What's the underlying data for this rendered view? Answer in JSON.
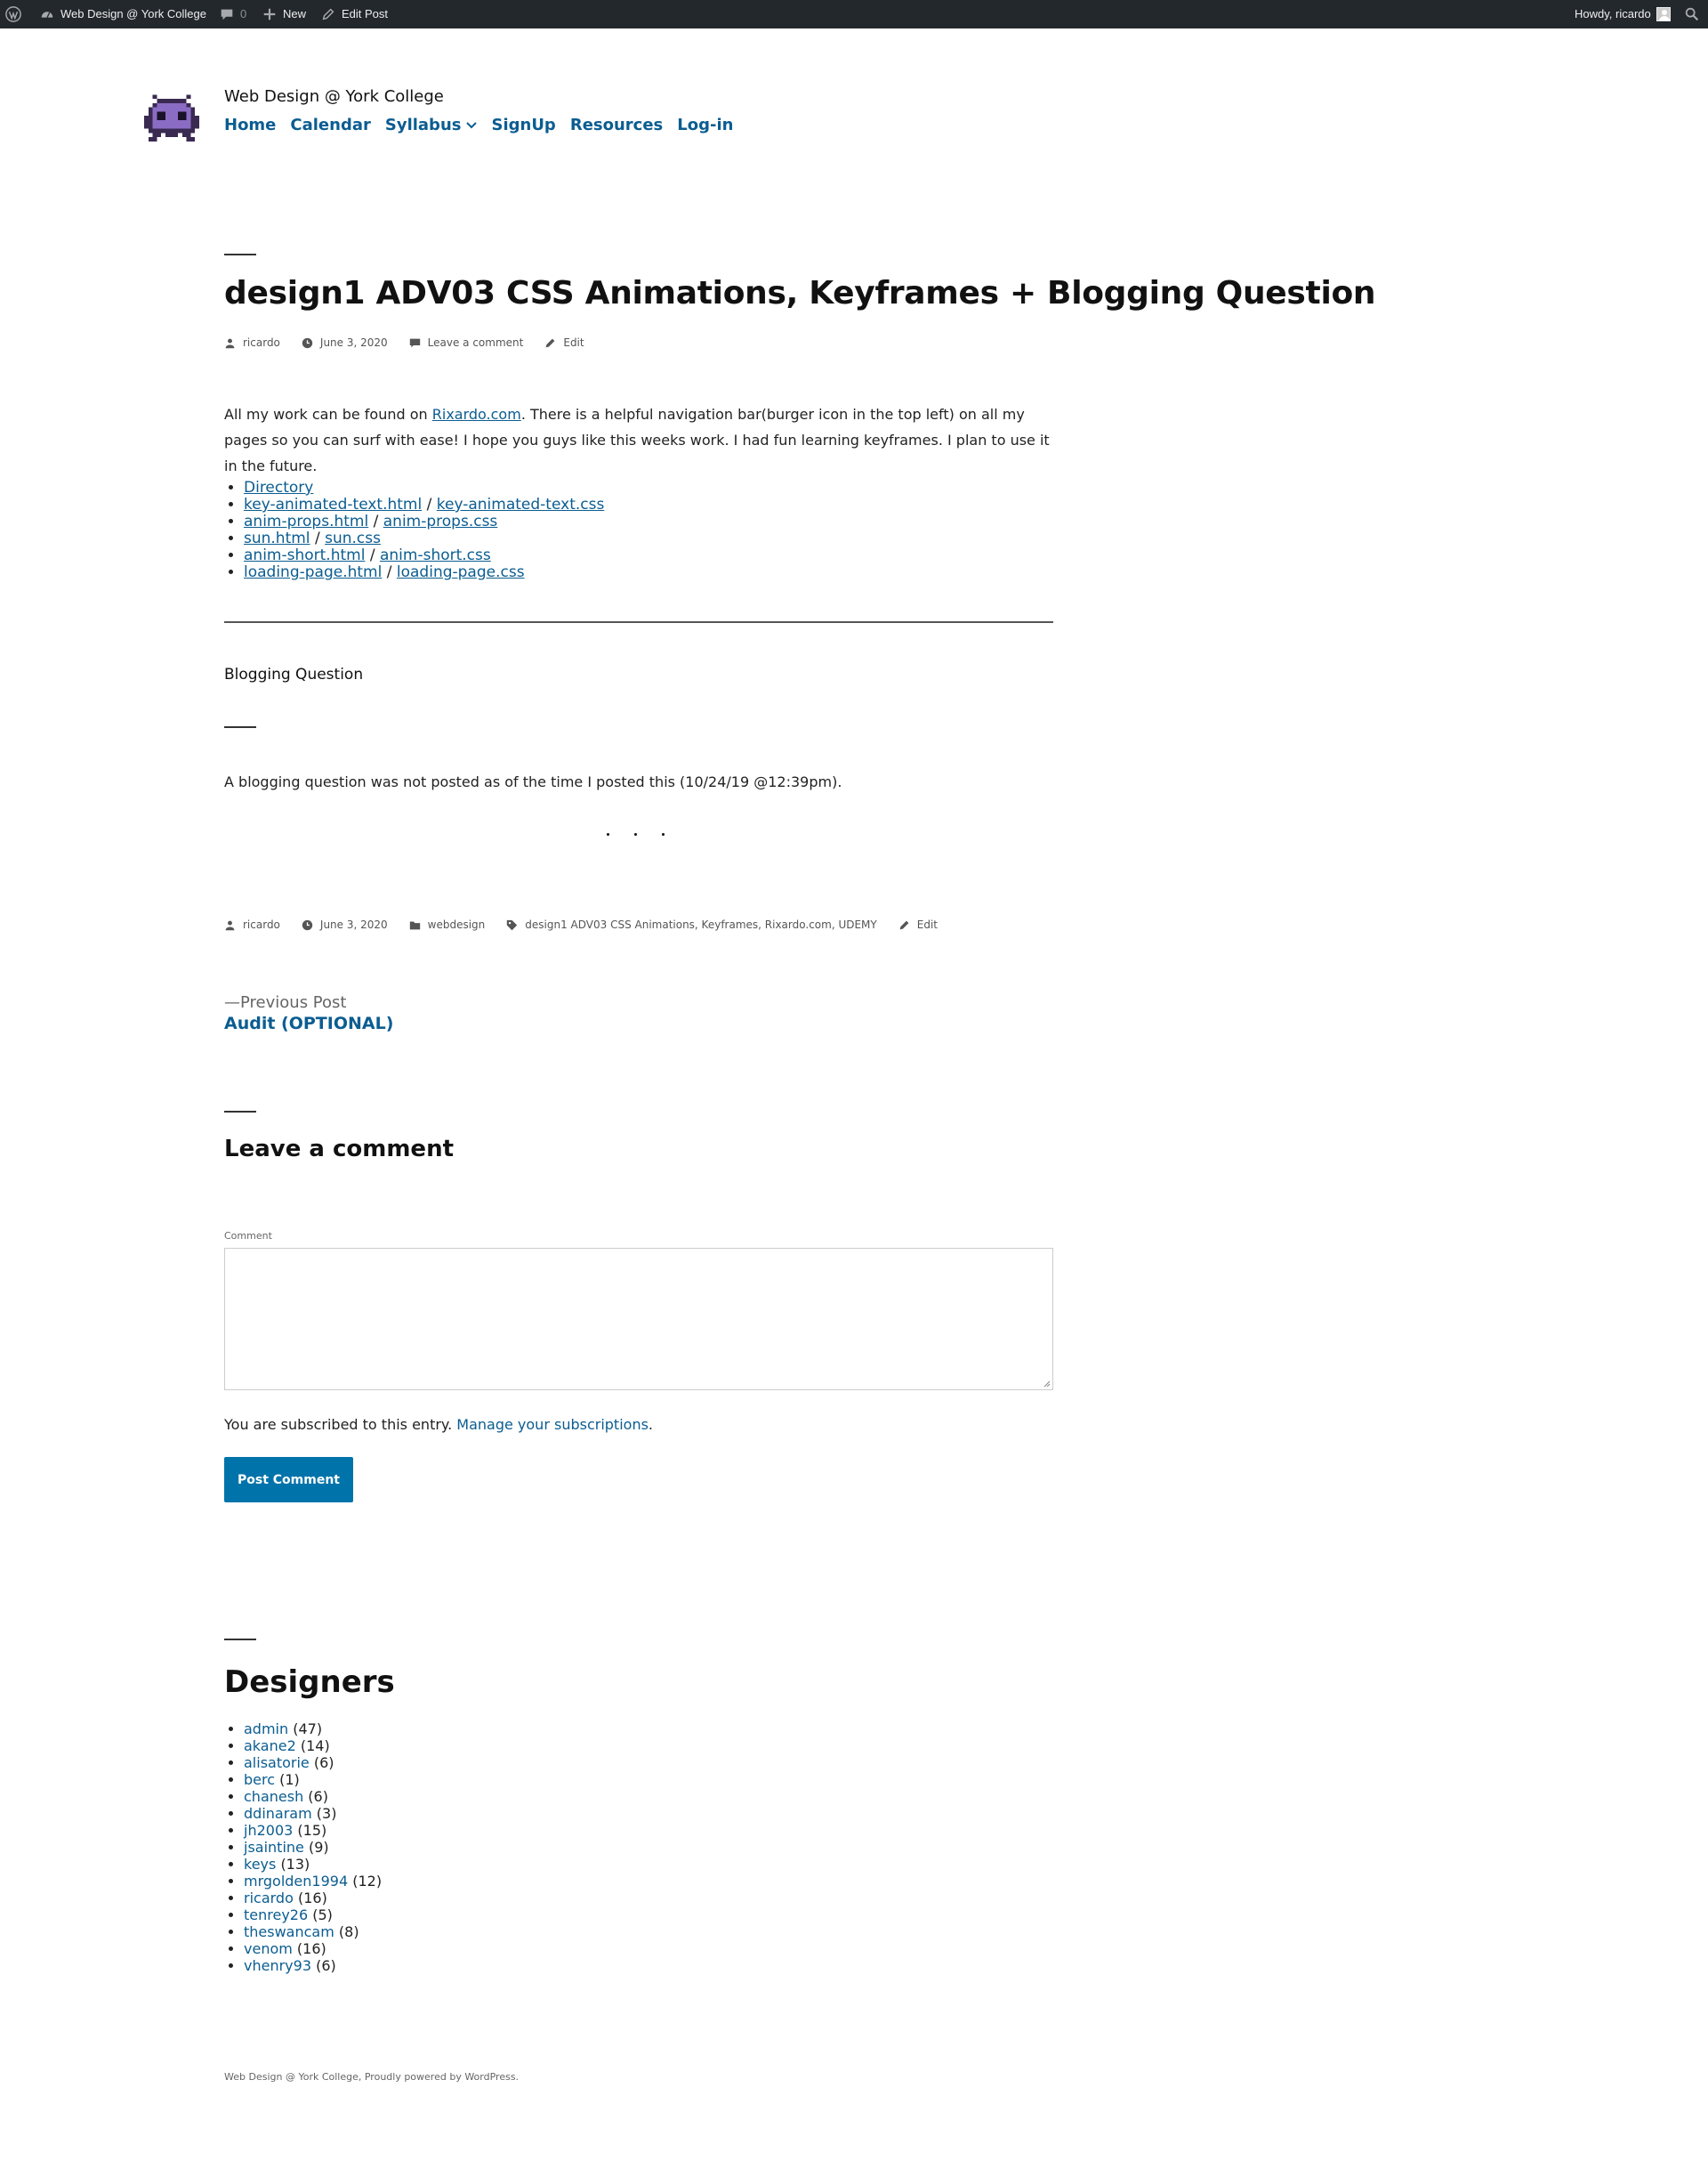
{
  "admin_bar": {
    "site_name": "Web Design @ York College",
    "comments_count": "0",
    "new_label": "New",
    "edit_label": "Edit Post",
    "howdy": "Howdy, ricardo"
  },
  "header": {
    "site_title": "Web Design @ York College",
    "nav": [
      "Home",
      "Calendar",
      "Syllabus",
      "SignUp",
      "Resources",
      "Log-in"
    ]
  },
  "post": {
    "title": "design1 ADV03 CSS Animations, Keyframes + Blogging Question",
    "meta": {
      "author": "ricardo",
      "date": "June 3, 2020",
      "comment_link": "Leave a comment",
      "edit": "Edit"
    },
    "intro_before": "All my work can be found on ",
    "intro_link": "Rixardo.com",
    "intro_after": ". There is a helpful navigation bar(burger icon in the top left) on all my pages so you can surf with ease! I hope you guys like this weeks work. I had fun learning keyframes. I plan to use it in the future.",
    "files": [
      {
        "a": "Directory",
        "b": ""
      },
      {
        "a": "key-animated-text.html",
        "b": "key-animated-text.css"
      },
      {
        "a": "anim-props.html",
        "b": "anim-props.css"
      },
      {
        "a": "sun.html",
        "b": "sun.css"
      },
      {
        "a": "anim-short.html",
        "b": "anim-short.css"
      },
      {
        "a": "loading-page.html",
        "b": "loading-page.css"
      }
    ],
    "separator": " / ",
    "blogging_heading": "Blogging Question",
    "blogging_text": "A blogging question was not posted as of the time I posted this (10/24/19 @12:39pm).",
    "footer_meta": {
      "author": "ricardo",
      "date": "June 3, 2020",
      "category": "webdesign",
      "tags": "design1 ADV03 CSS Animations, Keyframes, Rixardo.com, UDEMY",
      "edit": "Edit"
    }
  },
  "navigation": {
    "prev_label": "—Previous Post",
    "prev_title": "Audit (OPTIONAL)"
  },
  "comments": {
    "title": "Leave a comment",
    "comment_label": "Comment",
    "comment_value": "",
    "subscribed_text": "You are subscribed to this entry. ",
    "manage_link": "Manage your subscriptions",
    "period": ".",
    "submit_label": "Post Comment"
  },
  "designers": {
    "title": "Designers",
    "list": [
      {
        "name": "admin",
        "count": "(47)"
      },
      {
        "name": "akane2",
        "count": "(14)"
      },
      {
        "name": "alisatorie",
        "count": "(6)"
      },
      {
        "name": "berc",
        "count": "(1)"
      },
      {
        "name": "chanesh",
        "count": "(6)"
      },
      {
        "name": "ddinaram",
        "count": "(3)"
      },
      {
        "name": "jh2003",
        "count": "(15)"
      },
      {
        "name": "jsaintine",
        "count": "(9)"
      },
      {
        "name": "keys",
        "count": "(13)"
      },
      {
        "name": "mrgolden1994",
        "count": "(12)"
      },
      {
        "name": "ricardo",
        "count": "(16)"
      },
      {
        "name": "tenrey26",
        "count": "(5)"
      },
      {
        "name": "theswancam",
        "count": "(8)"
      },
      {
        "name": "venom",
        "count": "(16)"
      },
      {
        "name": "vhenry93",
        "count": "(6)"
      }
    ]
  },
  "footer": {
    "text": "Web Design @ York College, Proudly powered by WordPress."
  },
  "colors": {
    "admin_bar": "#23282d",
    "link": "#0b5d91",
    "button": "#0073aa"
  }
}
